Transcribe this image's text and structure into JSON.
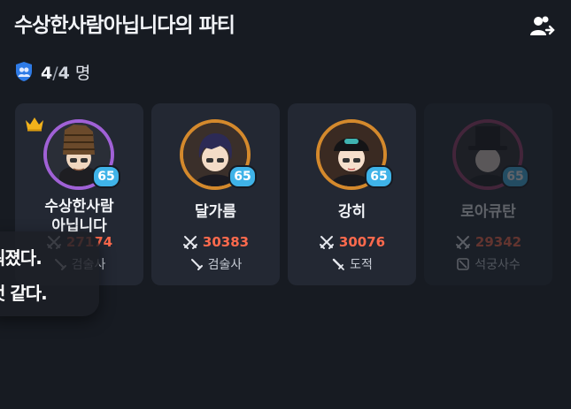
{
  "header": {
    "title": "수상한사람아닙니다의 파티",
    "party_button_icon": "party-manage-icon"
  },
  "party": {
    "current": "4",
    "separator": "/",
    "max": "4",
    "unit": "명",
    "icon": "party-members-icon"
  },
  "members": [
    {
      "name": "수상한사람\n아닙니다",
      "level": "65",
      "power": "27174",
      "job": "검술사",
      "leader": true,
      "ring_color": "#a061d6",
      "job_icon": "sword-icon"
    },
    {
      "name": "달가름",
      "level": "65",
      "power": "30383",
      "job": "검술사",
      "leader": false,
      "ring_color": "#d4892c",
      "job_icon": "sword-icon"
    },
    {
      "name": "강히",
      "level": "65",
      "power": "30076",
      "job": "도적",
      "leader": false,
      "ring_color": "#d4892c",
      "job_icon": "dagger-icon"
    },
    {
      "name": "로아큐탄",
      "level": "65",
      "power": "29342",
      "job": "석궁사수",
      "leader": false,
      "ring_color": "#a03a6d",
      "job_icon": "crossbow-icon",
      "dimmed": true
    }
  ],
  "toast": {
    "line1": "워졌다.",
    "line2": "것 같다."
  },
  "colors": {
    "background": "#171b22",
    "card": "#232833",
    "power": "#ff6a4d",
    "level_badge": "#3fb3e8"
  }
}
